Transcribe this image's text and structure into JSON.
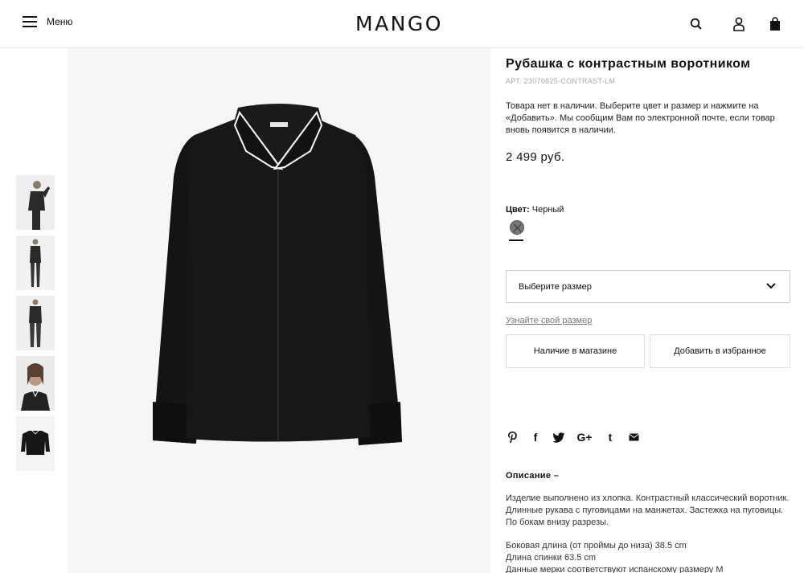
{
  "header": {
    "menu_label": "Меню",
    "logo": "MANGO",
    "icons": [
      "search-icon",
      "user-icon",
      "bag-icon"
    ]
  },
  "gallery": {
    "thumbnails": [
      {
        "label": "model-pose-1"
      },
      {
        "label": "model-full-1"
      },
      {
        "label": "model-full-2"
      },
      {
        "label": "model-portrait"
      },
      {
        "label": "shirt-flat"
      }
    ]
  },
  "product": {
    "title": "Рубашка с контрастным воротником",
    "article": "АРТ. 23070825-CONTRAST-LM",
    "stock_note": "Товара нет в наличии. Выберите цвет и размер и нажмите на «Добавить». Мы сообщим Вам по электронной почте, если товар вновь появится в наличии.",
    "price": "2 499 руб.",
    "color_label": "Цвет:",
    "color_value": "Черный",
    "swatch_color": "#777777",
    "size_placeholder": "Выберите размер",
    "size_guide": "Узнайте свой размер",
    "store_button": "Наличие в магазине",
    "favorite_button": "Добавить в избранное"
  },
  "share": {
    "icons": [
      "pinterest-icon",
      "facebook-icon",
      "twitter-icon",
      "google-plus-icon",
      "tumblr-icon",
      "email-icon"
    ],
    "gplus_glyph": "G+",
    "tumblr_glyph": "t",
    "facebook_glyph": "f"
  },
  "description": {
    "heading": "Описание –",
    "text": "Изделие выполнено из хлопка. Контрастный классический воротник. Длинные рукава с пуговицами на манжетах. Застежка на пуговицы. По бокам внизу разрезы.",
    "dim_1": "Боковая длина (от проймы до низа) 38.5 cm",
    "dim_2": "Длина спинки 63.5 cm",
    "dim_3": "Данные мерки соответствуют испанскому размеру M"
  }
}
